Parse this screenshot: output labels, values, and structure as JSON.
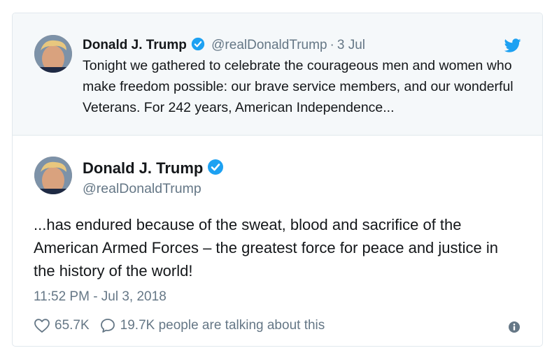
{
  "quoted_tweet": {
    "author_name": "Donald J. Trump",
    "handle": "@realDonaldTrump",
    "separator": "·",
    "date": "3 Jul",
    "text": "Tonight we gathered to celebrate the courageous men and women who make freedom possible: our brave service members, and our wonderful Veterans. For 242 years, American Independence..."
  },
  "main_tweet": {
    "author_name": "Donald J. Trump",
    "handle": "@realDonaldTrump",
    "text": "...has endured because of the sweat, blood and sacrifice of the American Armed Forces – the greatest force for peace and justice in the history of the world!",
    "timestamp": "11:52 PM - Jul 3, 2018",
    "likes": "65.7K",
    "talking": "19.7K people are talking about this"
  },
  "icons": {
    "verified": "verified-badge-icon",
    "bird": "twitter-bird-icon",
    "like": "heart-icon",
    "reply": "speech-bubble-icon",
    "info": "info-icon"
  },
  "colors": {
    "brand_blue": "#1da1f2",
    "secondary_text": "#657786",
    "quoted_background": "#f5f8fa",
    "border": "#e1e8ed"
  }
}
